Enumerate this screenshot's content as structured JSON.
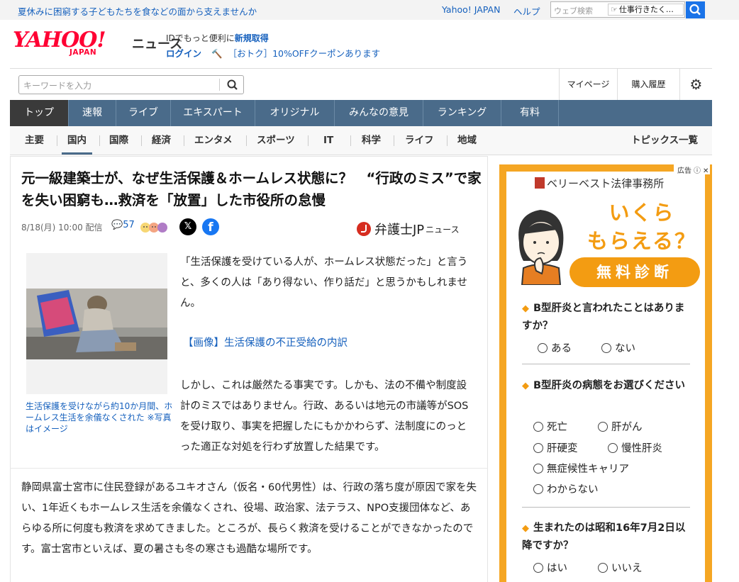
{
  "topbar": {
    "promo": "夏休みに困窮する子どもたちを食などの面から支えませんか",
    "yahoo_japan": "Yahoo! JAPAN",
    "help": "ヘルプ",
    "web_search_placeholder": "ウェブ検索",
    "search_suggestion": "仕事行きたく…"
  },
  "logo": {
    "yahoo": "YAHOO!",
    "japan": "JAPAN",
    "news": "ニュース"
  },
  "account": {
    "id_text": "IDでもっと便利に",
    "id_link": "新規取得",
    "login": "ログイン",
    "coupon": "［おトク］10%OFFクーポンあります"
  },
  "search": {
    "placeholder": "キーワードを入力",
    "mypage": "マイページ",
    "history": "購入履歴"
  },
  "main_nav": [
    "トップ",
    "速報",
    "ライブ",
    "エキスパート",
    "オリジナル",
    "みんなの意見",
    "ランキング",
    "有料"
  ],
  "sub_nav": [
    "主要",
    "国内",
    "国際",
    "経済",
    "エンタメ",
    "スポーツ",
    "IT",
    "科学",
    "ライフ",
    "地域"
  ],
  "sub_nav_right": "トピックス一覧",
  "article": {
    "headline": "元一級建築士が、なぜ生活保護＆ホームレス状態に？　“行政のミス”で家を失い困窮も…救済を「放置」した市役所の怠慢",
    "date": "8/18(月) 10:00 配信",
    "comment_count": "57",
    "source_main": "弁護士JP",
    "source_sub": "ニュース",
    "photo_caption": "生活保護を受けながら約10か月間、ホームレス生活を余儀なくされた ※写真はイメージ",
    "p1": "「生活保護を受けている人が、ホームレス状態だった」と言うと、多くの人は「あり得ない、作り話だ」と思うかもしれません。",
    "image_link": "【画像】生活保護の不正受給の内訳",
    "p2": "しかし、これは厳然たる事実です。しかも、法の不備や制度設計のミスではありません。行政、あるいは地元の市議等がSOSを受け取り、事実を把握したにもかかわらず、法制度にのっとった適正な対処を行わず放置した結果です。",
    "p3": "静岡県富士宮市に住民登録があるユキオさん（仮名・60代男性）は、行政の落ち度が原因で家を失い、1年近くもホームレス生活を余儀なくされ、役場、政治家、法テラス、NPO支援団体など、あらゆる所に何度も救済を求めてきました。ところが、長らく救済を受けることができなかったのです。富士宮市といえば、夏の暑さも冬の寒さも過酷な場所です。"
  },
  "ad": {
    "label": "広告",
    "firm": "ベリーベスト法律事務所",
    "headline_1": "いくら",
    "headline_2": "もらえる？",
    "cta": "無料診断",
    "q1": "B型肝炎と言われたことはありますか？",
    "q1_options": [
      "ある",
      "ない"
    ],
    "q2": "B型肝炎の病態をお選びください",
    "q2_options": [
      "死亡",
      "肝がん",
      "肝硬変",
      "慢性肝炎",
      "無症候性キャリア",
      "わからない"
    ],
    "q3": "生まれたのは昭和16年7月2日以降ですか？",
    "q3_options": [
      "はい",
      "いいえ"
    ]
  },
  "colors": {
    "nav_blue": "#4a6b8a",
    "link_blue": "#1560bd",
    "yahoo_red": "#ff0033",
    "ad_orange": "#f5a623"
  }
}
